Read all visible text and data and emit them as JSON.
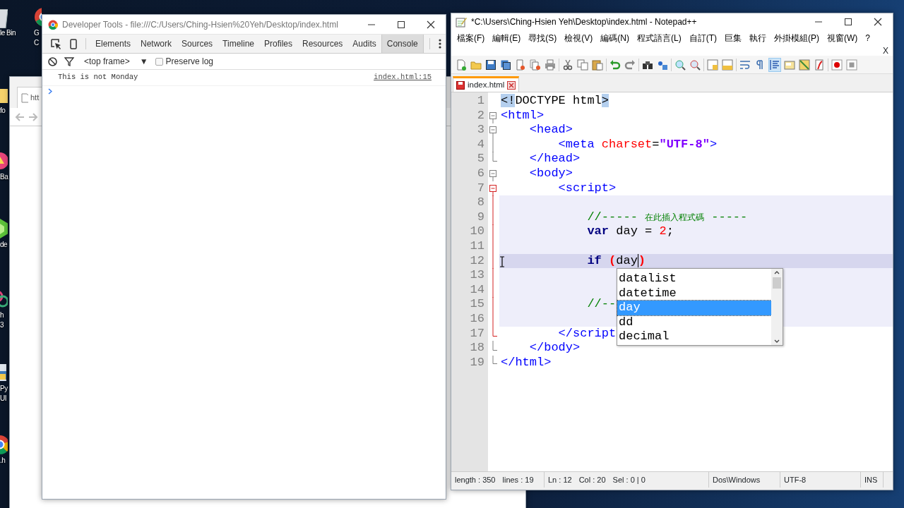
{
  "desktop": {
    "icons": [
      {
        "label_lines": [
          "le Bin"
        ]
      },
      {
        "label_lines": [
          "G",
          "C"
        ]
      },
      {
        "label_lines": [
          "fo"
        ]
      },
      {
        "label_lines": [
          "Ba"
        ]
      },
      {
        "label_lines": [
          "de"
        ]
      },
      {
        "label_lines": [
          "h",
          "3"
        ]
      },
      {
        "label_lines": [
          "Py",
          "UI"
        ]
      },
      {
        "label_lines": [
          ".h"
        ]
      }
    ]
  },
  "background_browser": {
    "tab_title": "htt"
  },
  "devtools": {
    "title": "Developer Tools - file:///C:/Users/Ching-Hsien%20Yeh/Desktop/index.html",
    "tabs": [
      {
        "label": "Elements",
        "selected": false
      },
      {
        "label": "Network",
        "selected": false
      },
      {
        "label": "Sources",
        "selected": false
      },
      {
        "label": "Timeline",
        "selected": false
      },
      {
        "label": "Profiles",
        "selected": false
      },
      {
        "label": "Resources",
        "selected": false
      },
      {
        "label": "Audits",
        "selected": false
      },
      {
        "label": "Console",
        "selected": true
      }
    ],
    "frame_select": {
      "value": "<top frame>",
      "caret": "▼"
    },
    "preserve_log": {
      "label": "Preserve log",
      "checked": false
    },
    "messages": [
      {
        "text": "This is not Monday",
        "source": "index.html:15"
      }
    ]
  },
  "notepad": {
    "title": "*C:\\Users\\Ching-Hsien Yeh\\Desktop\\index.html - Notepad++",
    "menu": [
      "檔案(F)",
      "編輯(E)",
      "尋找(S)",
      "檢視(V)",
      "編碼(N)",
      "程式語言(L)",
      "自訂(T)",
      "巨集",
      "執行",
      "外掛模組(P)",
      "視窗(W)",
      "?"
    ],
    "close_doc": "X",
    "toolbar": [
      {
        "pressed": false
      },
      {
        "pressed": false
      },
      {
        "pressed": false
      },
      {
        "pressed": false
      },
      {
        "pressed": false
      },
      {
        "pressed": false
      },
      {
        "pressed": false
      },
      {
        "pressed": false
      },
      {
        "pressed": false
      },
      {
        "pressed": false
      },
      {
        "pressed": false
      },
      {
        "pressed": false
      },
      {
        "pressed": false
      },
      {
        "pressed": false
      },
      {
        "pressed": false
      },
      {
        "pressed": false
      },
      {
        "pressed": false
      },
      {
        "pressed": false
      },
      {
        "pressed": false
      },
      {
        "pressed": false
      },
      {
        "pressed": true
      },
      {
        "pressed": false
      },
      {
        "pressed": false
      },
      {
        "pressed": false
      },
      {
        "pressed": false
      },
      {
        "pressed": false
      }
    ],
    "tabs": [
      {
        "label": "index.html",
        "selected": true
      }
    ],
    "lines": [
      {
        "number": "1",
        "block": false,
        "current": false,
        "tokens": [
          {
            "kind": "match",
            "text": "<!"
          },
          {
            "kind": "doctype",
            "text": "DOCTYPE html"
          },
          {
            "kind": "match",
            "text": ">"
          }
        ]
      },
      {
        "number": "2",
        "fold": {
          "kind": "box"
        },
        "block": false,
        "current": false,
        "active": false,
        "tokens": [
          {
            "kind": "tag",
            "text": "<html>"
          }
        ]
      },
      {
        "number": "3",
        "fold": {
          "kind": "box"
        },
        "block": false,
        "current": false,
        "active": false,
        "tokens": [
          {
            "kind": "tag",
            "text": "    <head>"
          }
        ]
      },
      {
        "number": "4",
        "fold": {
          "kind": "line"
        },
        "block": false,
        "current": false,
        "active": false,
        "tokens": [
          {
            "kind": "tag",
            "text": "        <meta "
          },
          {
            "kind": "attr",
            "text": "charset"
          },
          {
            "kind": "plain",
            "text": "="
          },
          {
            "kind": "string",
            "text": "\"UTF-8\""
          },
          {
            "kind": "tag",
            "text": ">"
          }
        ]
      },
      {
        "number": "5",
        "fold": {
          "kind": "end"
        },
        "block": false,
        "current": false,
        "active": false,
        "tokens": [
          {
            "kind": "tag",
            "text": "    </head>"
          }
        ]
      },
      {
        "number": "6",
        "fold": {
          "kind": "box"
        },
        "block": false,
        "current": false,
        "active": false,
        "tokens": [
          {
            "kind": "tag",
            "text": "    <body>"
          }
        ]
      },
      {
        "number": "7",
        "fold": {
          "kind": "box"
        },
        "block": false,
        "current": false,
        "active": true,
        "tokens": [
          {
            "kind": "tag",
            "text": "        <script>"
          }
        ]
      },
      {
        "number": "8",
        "fold": {
          "kind": "line"
        },
        "block": true,
        "current": false,
        "active": true
      },
      {
        "number": "9",
        "fold": {
          "kind": "line"
        },
        "block": true,
        "current": false,
        "active": true,
        "tokens": [
          {
            "kind": "comment",
            "text": "            //----- "
          },
          {
            "kind": "note",
            "text": "在此插入程式碼"
          },
          {
            "kind": "comment",
            "text": " -----"
          }
        ]
      },
      {
        "number": "10",
        "fold": {
          "kind": "line"
        },
        "block": true,
        "current": false,
        "active": true,
        "tokens": [
          {
            "kind": "keyword",
            "text": "            var"
          },
          {
            "kind": "plain",
            "text": " day = "
          },
          {
            "kind": "number",
            "text": "2"
          },
          {
            "kind": "plain",
            "text": ";"
          }
        ]
      },
      {
        "number": "11",
        "fold": {
          "kind": "line"
        },
        "block": true,
        "current": false,
        "active": true
      },
      {
        "number": "12",
        "fold": {
          "kind": "line"
        },
        "block": true,
        "current": true,
        "active": true,
        "tokens": [
          {
            "kind": "keyword",
            "text": "            if"
          },
          {
            "kind": "brace",
            "text": " ("
          },
          {
            "kind": "plain",
            "text": "day",
            "caret": true
          },
          {
            "kind": "brace",
            "text": ")"
          }
        ]
      },
      {
        "number": "13",
        "fold": {
          "kind": "line"
        },
        "block": true,
        "current": false,
        "active": true
      },
      {
        "number": "14",
        "fold": {
          "kind": "line"
        },
        "block": true,
        "current": false,
        "active": true
      },
      {
        "number": "15",
        "fold": {
          "kind": "line"
        },
        "block": true,
        "current": false,
        "active": true,
        "tokens": [
          {
            "kind": "comment",
            "text": "            //--"
          }
        ]
      },
      {
        "number": "16",
        "fold": {
          "kind": "line"
        },
        "block": true,
        "current": false,
        "active": true
      },
      {
        "number": "17",
        "fold": {
          "kind": "end"
        },
        "block": false,
        "current": false,
        "active": true,
        "tokens": [
          {
            "kind": "tag",
            "text": "        </script"
          }
        ]
      },
      {
        "number": "18",
        "fold": {
          "kind": "end"
        },
        "block": false,
        "current": false,
        "active": false,
        "tokens": [
          {
            "kind": "tag",
            "text": "    </body>"
          }
        ]
      },
      {
        "number": "19",
        "fold": {
          "kind": "last"
        },
        "block": false,
        "current": false,
        "active": false,
        "tokens": [
          {
            "kind": "tag",
            "text": "</html>"
          }
        ]
      }
    ],
    "autocomplete": {
      "items": [
        {
          "text": "datalist",
          "selected": false
        },
        {
          "text": "datetime",
          "selected": false
        },
        {
          "text": "day",
          "selected": true
        },
        {
          "text": "dd",
          "selected": false
        },
        {
          "text": "decimal",
          "selected": false
        }
      ]
    },
    "status_bar": [
      {
        "items": [
          "length : 350",
          "lines : 19"
        ]
      },
      {
        "items": [
          "Ln : 12",
          "Col : 20",
          "Sel : 0 | 0"
        ]
      },
      {
        "items": [
          "Dos\\Windows"
        ]
      },
      {
        "items": [
          "UTF-8"
        ]
      },
      {
        "items": [
          "INS"
        ]
      }
    ]
  }
}
